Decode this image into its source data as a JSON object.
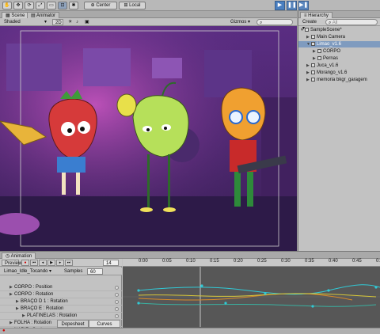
{
  "toolbar": {
    "center_label": "Center",
    "local_label": "Local",
    "play_icon": "play-icon",
    "pause_icon": "pause-icon",
    "step_icon": "step-icon"
  },
  "scene": {
    "tab_scene": "Scene",
    "tab_animator": "Animator",
    "shading_mode": "Shaded",
    "mode_2d": "2D",
    "gizmos_label": "Gizmos"
  },
  "hierarchy": {
    "tab_label": "Hierarchy",
    "create_label": "Create",
    "search_placeholder": "All",
    "items": [
      {
        "label": "SampleScene*",
        "indent": 0,
        "expanded": true,
        "selected": false,
        "scene": true
      },
      {
        "label": "Main Camera",
        "indent": 1,
        "expanded": false,
        "selected": false
      },
      {
        "label": "Limao_v1.6",
        "indent": 1,
        "expanded": true,
        "selected": true
      },
      {
        "label": "CORPO",
        "indent": 2,
        "expanded": false,
        "selected": false
      },
      {
        "label": "Pernas",
        "indent": 2,
        "expanded": false,
        "selected": false
      },
      {
        "label": "Juca_v1.6",
        "indent": 1,
        "expanded": false,
        "selected": false
      },
      {
        "label": "Morango_v1.6",
        "indent": 1,
        "expanded": false,
        "selected": false
      },
      {
        "label": "memoria bkgr_garagem",
        "indent": 1,
        "expanded": false,
        "selected": false
      }
    ]
  },
  "animation": {
    "tab_label": "Animation",
    "preview_label": "Preview",
    "frame_value": "14",
    "clip_name": "Limao_Idle_Tocando",
    "samples_label": "Samples",
    "samples_value": "60",
    "timeline_ticks": [
      "0:00",
      "0:05",
      "0:10",
      "0:15",
      "0:20",
      "0:25",
      "0:30",
      "0:35",
      "0:40",
      "0:45",
      "0:50"
    ],
    "properties": [
      {
        "label": "CORPO : Position",
        "indent": 1
      },
      {
        "label": "CORPO : Rotation",
        "indent": 1
      },
      {
        "label": "BRAÇO D 1 : Rotation",
        "indent": 2
      },
      {
        "label": "BRAÇO E : Rotation",
        "indent": 2
      },
      {
        "label": "PLATINELAS : Rotation",
        "indent": 3
      },
      {
        "label": "FOLHA : Rotation",
        "indent": 1
      },
      {
        "label": "NARIZ : Scale",
        "indent": 1
      }
    ],
    "dopesheet_label": "Dopesheet",
    "curves_label": "Curves"
  },
  "colors": {
    "accent": "#4a7fc0",
    "selection": "#7f9bbf",
    "curve_cyan": "#31c9d6",
    "curve_orange": "#d88a2a",
    "curve_yellow": "#d6c63a"
  }
}
